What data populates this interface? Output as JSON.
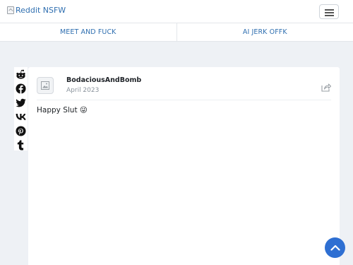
{
  "header": {
    "brand_text": "Reddit NSFW",
    "brand_icon": "broken-image-icon",
    "menu_icon": "hamburger-icon"
  },
  "tabs": [
    {
      "label": "MEET AND FUCK"
    },
    {
      "label": "AI JERK OFFK"
    }
  ],
  "share_rail": {
    "icons": [
      "reddit-icon",
      "facebook-icon",
      "twitter-icon",
      "vk-icon",
      "pinterest-icon",
      "tumblr-icon"
    ]
  },
  "post": {
    "author": "BodaciousAndBomb",
    "date": "April 2023",
    "text": "Happy Slut 😜",
    "avatar_icon": "broken-image-icon",
    "share_icon": "share-icon"
  },
  "scroll_top_icon": "chevron-up-icon",
  "colors": {
    "background": "#eef1f5",
    "link": "#2f6fb0",
    "accent": "#2e6fd2"
  }
}
